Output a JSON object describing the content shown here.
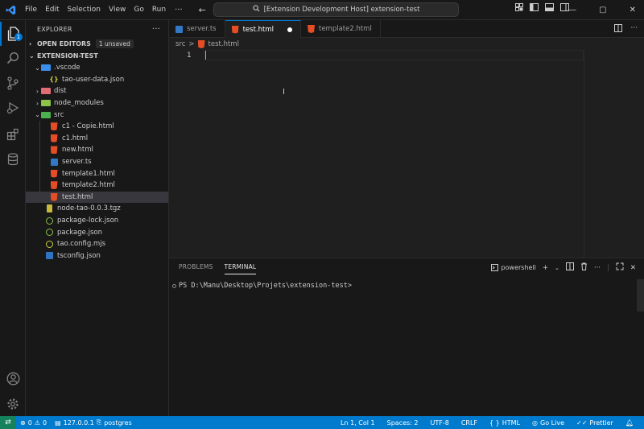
{
  "titlebar": {
    "menu": [
      "File",
      "Edit",
      "Selection",
      "View",
      "Go",
      "Run"
    ],
    "more": "···",
    "command_center": "[Extension Development Host] extension-test",
    "accent": "#0078d4"
  },
  "activity_bar": {
    "explorer_badge": "1"
  },
  "sidebar": {
    "title": "EXPLORER",
    "more": "···",
    "open_editors": {
      "label": "OPEN EDITORS",
      "badge": "1 unsaved"
    },
    "project": {
      "label": "EXTENSION-TEST"
    },
    "tree": [
      {
        "label": ".vscode",
        "kind": "folder-open"
      },
      {
        "label": "tao-user-data.json",
        "kind": "json"
      },
      {
        "label": "dist",
        "kind": "folder"
      },
      {
        "label": "node_modules",
        "kind": "folder"
      },
      {
        "label": "src",
        "kind": "folder-open"
      },
      {
        "label": "c1 - Copie.html",
        "kind": "html"
      },
      {
        "label": "c1.html",
        "kind": "html"
      },
      {
        "label": "new.html",
        "kind": "html"
      },
      {
        "label": "server.ts",
        "kind": "ts"
      },
      {
        "label": "template1.html",
        "kind": "html"
      },
      {
        "label": "template2.html",
        "kind": "html"
      },
      {
        "label": "test.html",
        "kind": "html",
        "selected": true
      },
      {
        "label": "node-tao-0.0.3.tgz",
        "kind": "tgz"
      },
      {
        "label": "package-lock.json",
        "kind": "npm"
      },
      {
        "label": "package.json",
        "kind": "npm"
      },
      {
        "label": "tao.config.mjs",
        "kind": "mjs"
      },
      {
        "label": "tsconfig.json",
        "kind": "tsconfig"
      }
    ]
  },
  "tabs": [
    {
      "label": "server.ts",
      "kind": "ts",
      "active": false
    },
    {
      "label": "test.html",
      "kind": "html",
      "active": true,
      "dirty": true
    },
    {
      "label": "template2.html",
      "kind": "html",
      "active": false
    }
  ],
  "breadcrumb": {
    "folder": "src",
    "separator": ">",
    "file": "test.html"
  },
  "editor": {
    "line_number": "1"
  },
  "panel": {
    "tabs": [
      "PROBLEMS",
      "TERMINAL"
    ],
    "active_tab": "TERMINAL",
    "shell": "powershell",
    "prompt": "PS D:\\Manu\\Desktop\\Projets\\extension-test>"
  },
  "statusbar": {
    "errors": "0",
    "warnings": "0",
    "db_host": "127.0.0.1",
    "db_name": "postgres",
    "position": "Ln 1, Col 1",
    "spaces": "Spaces: 2",
    "encoding": "UTF-8",
    "eol": "CRLF",
    "language": "HTML",
    "golive": "Go Live",
    "formatter": "Prettier",
    "color": "#007acc",
    "remote_color": "#16825d"
  }
}
